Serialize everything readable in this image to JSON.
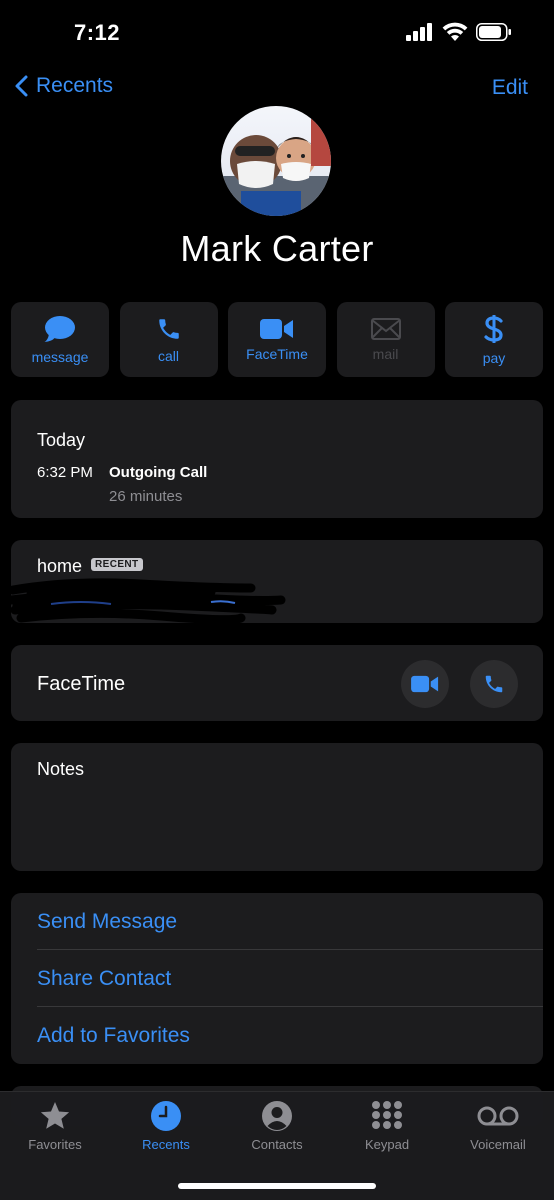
{
  "status_bar": {
    "time": "7:12"
  },
  "nav": {
    "back_label": "Recents",
    "edit_label": "Edit"
  },
  "contact": {
    "name": "Mark Carter"
  },
  "actions": [
    {
      "label": "message",
      "icon": "message-bubble-icon",
      "enabled": true
    },
    {
      "label": "call",
      "icon": "phone-icon",
      "enabled": true
    },
    {
      "label": "FaceTime",
      "icon": "video-camera-icon",
      "enabled": true
    },
    {
      "label": "mail",
      "icon": "envelope-icon",
      "enabled": false
    },
    {
      "label": "pay",
      "icon": "dollar-icon",
      "enabled": true
    }
  ],
  "recent_calls": {
    "day": "Today",
    "time": "6:32 PM",
    "type": "Outgoing Call",
    "duration": "26 minutes"
  },
  "phone": {
    "label": "home",
    "badge": "RECENT"
  },
  "facetime": {
    "label": "FaceTime"
  },
  "notes": {
    "label": "Notes"
  },
  "links": [
    {
      "label": "Send Message"
    },
    {
      "label": "Share Contact"
    },
    {
      "label": "Add to Favorites"
    }
  ],
  "tabs": [
    {
      "label": "Favorites",
      "icon": "star-icon",
      "active": false
    },
    {
      "label": "Recents",
      "icon": "clock-icon",
      "active": true
    },
    {
      "label": "Contacts",
      "icon": "person-circle-icon",
      "active": false
    },
    {
      "label": "Keypad",
      "icon": "keypad-icon",
      "active": false
    },
    {
      "label": "Voicemail",
      "icon": "voicemail-icon",
      "active": false
    }
  ],
  "colors": {
    "accent": "#3a8ff5",
    "card": "#1c1c1e",
    "background": "#000000"
  }
}
